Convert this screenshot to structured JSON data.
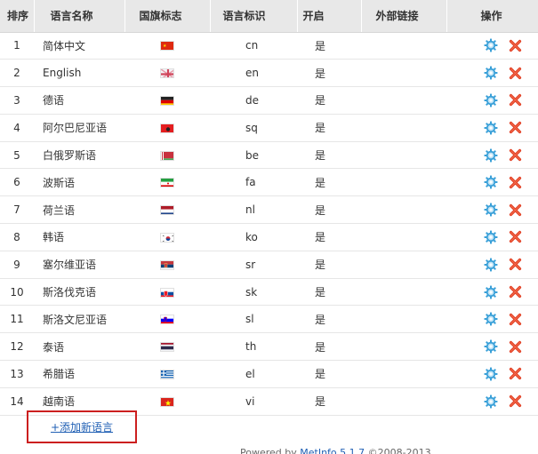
{
  "headers": {
    "index": "排序",
    "name": "语言名称",
    "flag": "国旗标志",
    "code": "语言标识",
    "enabled": "开启",
    "external": "外部链接",
    "actions": "操作"
  },
  "languages": [
    {
      "index": "1",
      "name": "简体中文",
      "code": "cn",
      "enabled": "是",
      "flag": "cn-flag-icon"
    },
    {
      "index": "2",
      "name": "English",
      "code": "en",
      "enabled": "是",
      "flag": "uk-flag-icon"
    },
    {
      "index": "3",
      "name": "德语",
      "code": "de",
      "enabled": "是",
      "flag": "de-flag-icon"
    },
    {
      "index": "4",
      "name": "阿尔巴尼亚语",
      "code": "sq",
      "enabled": "是",
      "flag": "al-flag-icon"
    },
    {
      "index": "5",
      "name": "白俄罗斯语",
      "code": "be",
      "enabled": "是",
      "flag": "by-flag-icon"
    },
    {
      "index": "6",
      "name": "波斯语",
      "code": "fa",
      "enabled": "是",
      "flag": "ir-flag-icon"
    },
    {
      "index": "7",
      "name": "荷兰语",
      "code": "nl",
      "enabled": "是",
      "flag": "nl-flag-icon"
    },
    {
      "index": "8",
      "name": "韩语",
      "code": "ko",
      "enabled": "是",
      "flag": "kr-flag-icon"
    },
    {
      "index": "9",
      "name": "塞尔维亚语",
      "code": "sr",
      "enabled": "是",
      "flag": "rs-flag-icon"
    },
    {
      "index": "10",
      "name": "斯洛伐克语",
      "code": "sk",
      "enabled": "是",
      "flag": "sk-flag-icon"
    },
    {
      "index": "11",
      "name": "斯洛文尼亚语",
      "code": "sl",
      "enabled": "是",
      "flag": "si-flag-icon"
    },
    {
      "index": "12",
      "name": "泰语",
      "code": "th",
      "enabled": "是",
      "flag": "th-flag-icon"
    },
    {
      "index": "13",
      "name": "希腊语",
      "code": "el",
      "enabled": "是",
      "flag": "gr-flag-icon"
    },
    {
      "index": "14",
      "name": "越南语",
      "code": "vi",
      "enabled": "是",
      "flag": "vn-flag-icon"
    }
  ],
  "add_link": "+添加新语言",
  "footer": {
    "prefix": "Powered by ",
    "brand": "MetInfo 5.1.7",
    "suffix": " ©2008-2013 "
  },
  "colors": {
    "header_bg": "#e8e8e8",
    "link": "#1f5fb4",
    "highlight_border": "#cc1f1f",
    "delete": "#e03b1f",
    "gear": "#3aa0d8"
  }
}
